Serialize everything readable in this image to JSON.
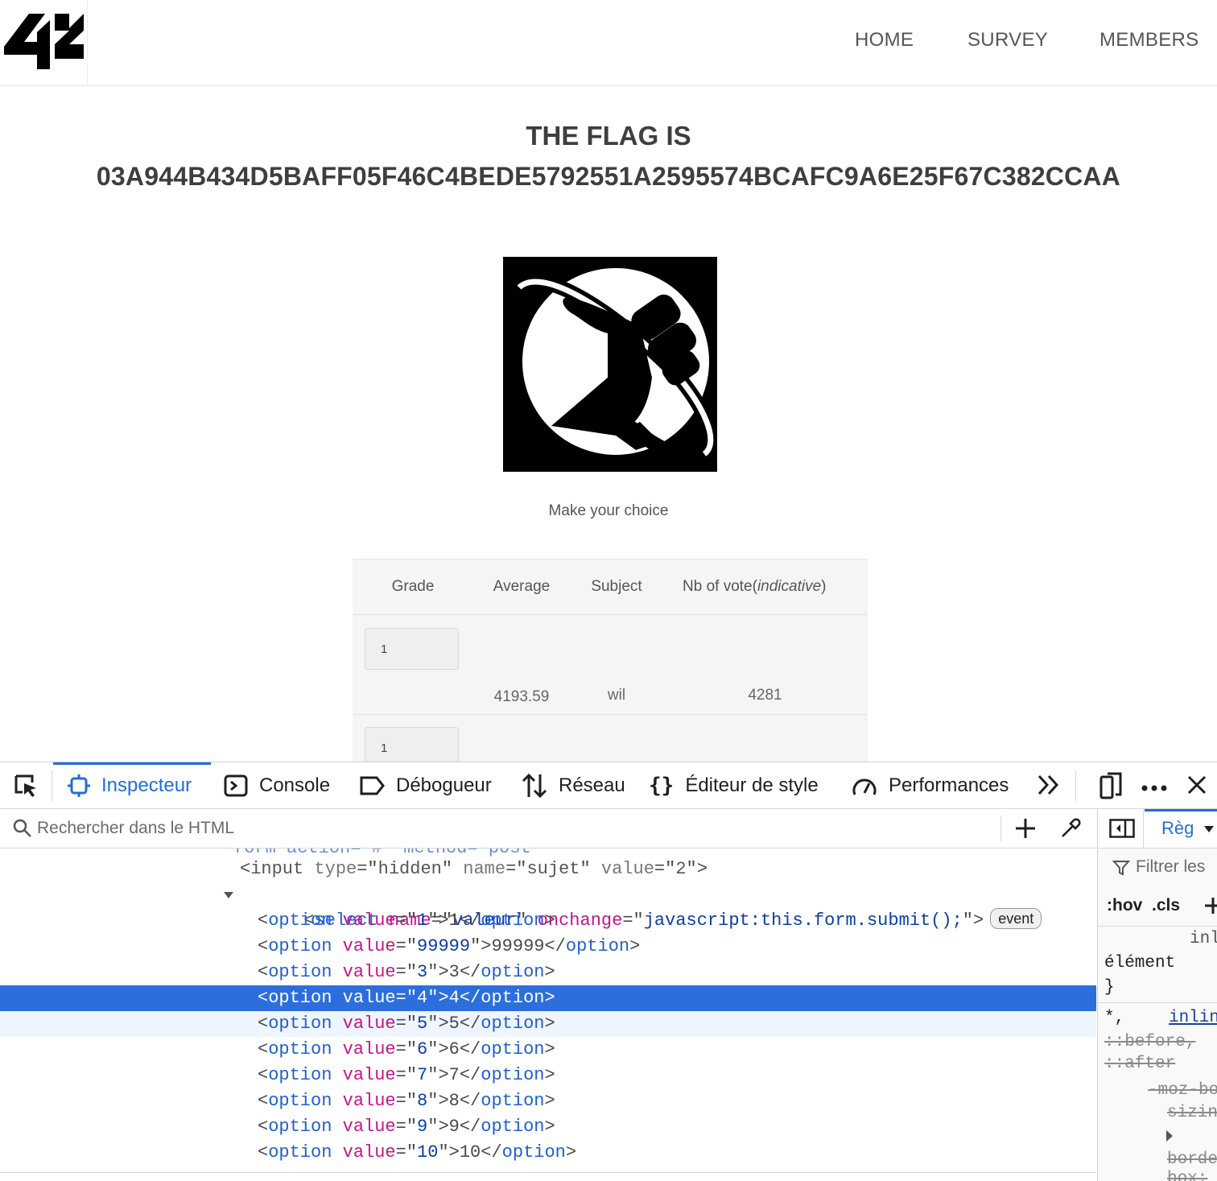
{
  "header": {
    "logo_text": "42",
    "nav": [
      "HOME",
      "SURVEY",
      "MEMBERS"
    ]
  },
  "main": {
    "flag_title": "THE FLAG IS",
    "flag_value": "03A944B434D5BAFF05F46C4BEDE5792551A2595574BCAFC9A6E25F67C382CCAA",
    "choice_text": "Make your choice"
  },
  "survey_table": {
    "headers": [
      "Grade",
      "Average",
      "Subject",
      "Nb of vote("
    ],
    "header_italic_suffix": "indicative",
    "header_close": ")",
    "rows": [
      {
        "grade": "1",
        "average": "4193.59",
        "subject": "wil",
        "votes": "4281"
      },
      {
        "grade": "1"
      }
    ]
  },
  "devtools": {
    "tabs": [
      "Inspecteur",
      "Console",
      "Débogueur",
      "Réseau",
      "Éditeur de style",
      "Performances"
    ],
    "search_placeholder": "Rechercher dans le HTML",
    "rules_tab": "Règ",
    "filter_text": "Filtrer les",
    "pseudo": ":hov  .cls",
    "rules_lines": [
      "inl",
      "élément",
      "}",
      "*,",
      "inlin",
      "::before,",
      "::after",
      "-moz-bo",
      "sizin",
      "borde",
      "box:"
    ],
    "tree": {
      "form_partial": "form action=\"#\" method=\"post\"",
      "input_line": {
        "tag": "input",
        "attrs": [
          [
            "type",
            "hidden"
          ],
          [
            "name",
            "sujet"
          ],
          [
            "value",
            "2"
          ]
        ]
      },
      "select_line": {
        "tag": "select",
        "attrs": [
          [
            "name",
            "valeur"
          ],
          [
            "onchange",
            "javascript:this.form.submit();"
          ]
        ],
        "badge": "event"
      },
      "options": [
        {
          "value": "1",
          "text": "1"
        },
        {
          "value": "99999",
          "text": "99999"
        },
        {
          "value": "3",
          "text": "3"
        },
        {
          "value": "4",
          "text": "4"
        },
        {
          "value": "5",
          "text": "5"
        },
        {
          "value": "6",
          "text": "6"
        },
        {
          "value": "7",
          "text": "7"
        },
        {
          "value": "8",
          "text": "8"
        },
        {
          "value": "9",
          "text": "9"
        },
        {
          "value": "10",
          "text": "10"
        }
      ],
      "selected_option_value": "4",
      "hovered_option_value": "5"
    }
  }
}
